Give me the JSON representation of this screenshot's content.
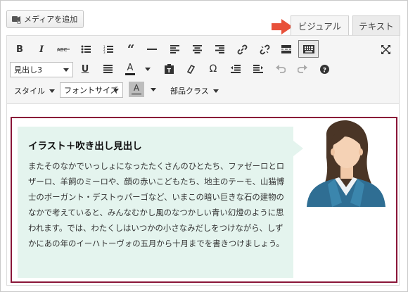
{
  "toolbar": {
    "add_media_label": "メディアを追加",
    "format_select": "見出し3",
    "style_menu": "スタイル",
    "fontsize_select": "フォントサイズ",
    "parts_class_menu": "部品クラス"
  },
  "tabs": {
    "visual": "ビジュアル",
    "text": "テキスト"
  },
  "content": {
    "heading": "イラスト＋吹き出し見出し",
    "body": "またそのなかでいっしょになったたくさんのひとたち、ファゼーロとロザーロ、羊飼のミーロや、顔の赤いこどもたち、地主のテーモ、山猫博士のボーガント・デストゥパーゴなど、いまこの暗い巨きな石の建物のなかで考えていると、みんなむかし風のなつかしい青い幻燈のように思われます。では、わたくしはいつかの小さなみだしをつけながら、しずかにあの年のイーハトーヴォの五月から十月までを書きつけましょう。"
  },
  "colors": {
    "callout_border": "#8a1538",
    "bubble_bg": "#e4f4ee",
    "arrow": "#e8513a",
    "avatar_jacket": "#2f6e93"
  }
}
